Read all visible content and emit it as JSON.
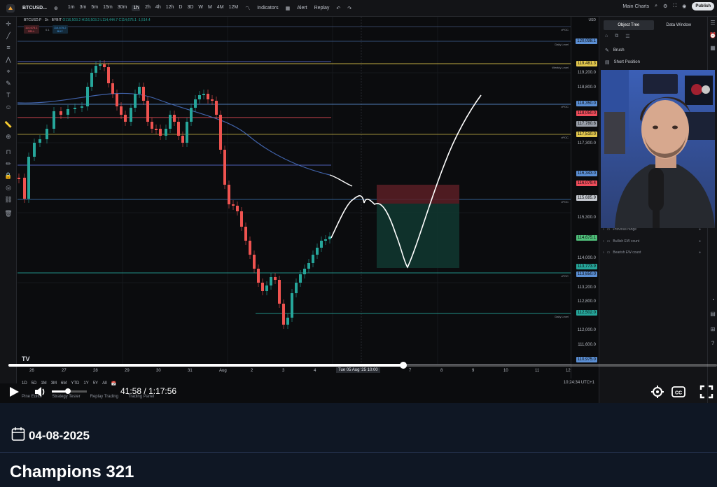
{
  "toolbar": {
    "symbol": "BTCUSD...",
    "timeframes": [
      "1m",
      "3m",
      "5m",
      "15m",
      "30m",
      "1h",
      "2h",
      "4h",
      "12h",
      "D",
      "3D",
      "W",
      "M",
      "4M",
      "12M"
    ],
    "active_timeframe": "1h",
    "indicators_label": "Indicators",
    "alert_label": "Alert",
    "replay_label": "Replay",
    "layout_label": "Main Charts",
    "publish_label": "Publish"
  },
  "chart": {
    "symbol_line": "BTCUSD.P · 1h · BYBIT",
    "ohlc": "O116,503.2 H116,503.2 L114,444.7 C114,675.1 -1,514.4",
    "sell_price": "114,675.1",
    "sell_label": "SELL",
    "spread": "0.1",
    "buy_price": "114,675.2",
    "buy_label": "BUY"
  },
  "price_scale": {
    "currency": "USD",
    "labels": [
      "119,200.0",
      "118,800.0",
      "117,300.0",
      "115,300.0",
      "114,000.0",
      "113,200.0",
      "112,800.0",
      "112,000.0",
      "111,600.0"
    ],
    "tags": [
      {
        "text": "120,098.1",
        "color": "#5b8fd4"
      },
      {
        "text": "119,481.3",
        "color": "#e2c74d"
      },
      {
        "text": "118,350.0",
        "color": "#5b8fd4"
      },
      {
        "text": "118,050.0",
        "color": "#ef4d5b"
      },
      {
        "text": "117,780.6",
        "color": "#9aa0aa"
      },
      {
        "text": "117,510.0",
        "color": "#e2c74d"
      },
      {
        "text": "116,343.0",
        "color": "#5b8fd4"
      },
      {
        "text": "116,079.4",
        "color": "#ef4d5b"
      },
      {
        "text": "115,685.9",
        "color": "#c7cbd2"
      },
      {
        "text": "114,675.1",
        "color": "#4fbf7a"
      },
      {
        "text": "113,773.9",
        "color": "#26a69a"
      },
      {
        "text": "113,650.0",
        "color": "#5b8fd4"
      },
      {
        "text": "112,502.0",
        "color": "#26a69a"
      },
      {
        "text": "110,975.0",
        "color": "#5b8fd4"
      }
    ],
    "line_labels": {
      "vpoc1": "vPOC",
      "daily": "Daily Level",
      "weekly": "Weekly Level"
    }
  },
  "time_axis": {
    "ticks": [
      "26",
      "27",
      "28",
      "29",
      "30",
      "31",
      "Aug",
      "2",
      "3",
      "4",
      "7",
      "8",
      "9",
      "10",
      "11",
      "12"
    ],
    "cursor_label": "Tue 05 Aug '25   10:00"
  },
  "ranges": [
    "1D",
    "5D",
    "1M",
    "3M",
    "6M",
    "YTD",
    "1Y",
    "5Y",
    "All"
  ],
  "clock": "10:24:34 UTC+1",
  "bottom_tabs": [
    "Pine Editor",
    "Strategy Tester",
    "Replay Trading",
    "Trading Panel"
  ],
  "right_panel": {
    "tabs": [
      "Object Tree",
      "Data Window"
    ],
    "items": [
      "Brush",
      "Short Position"
    ],
    "objects": [
      "Previous range",
      "Bullish EW count",
      "Bearish EW count"
    ]
  },
  "player": {
    "progress": 0.557,
    "volume": 0.45,
    "current_time": "41:58",
    "separator": "/",
    "total_time": "1:17:56"
  },
  "page": {
    "date": "04-08-2025",
    "title": "Champions 321"
  }
}
